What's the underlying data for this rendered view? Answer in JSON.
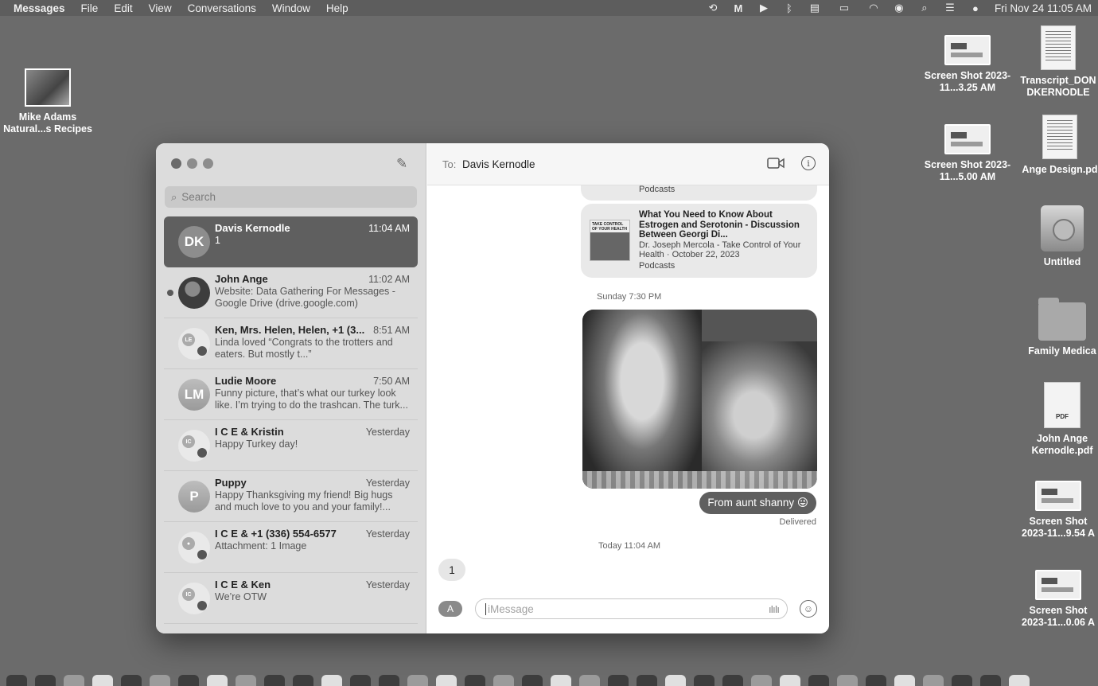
{
  "menubar": {
    "app": "Messages",
    "items": [
      "File",
      "Edit",
      "View",
      "Conversations",
      "Window",
      "Help"
    ],
    "clock": "Fri Nov 24  11:05 AM",
    "status_icons": [
      "sync-icon",
      "malwarebytes-icon",
      "play-icon",
      "bluetooth-icon",
      "keyboard-icon",
      "battery-icon",
      "wifi-icon",
      "user-icon",
      "search-icon",
      "control-center-icon",
      "siri-icon"
    ]
  },
  "desktop": {
    "icons": [
      {
        "label": "Mike Adams Natural...s Recipes",
        "type": "photo"
      },
      {
        "label": "Screen Shot 2023-11...3.25 AM",
        "type": "screenshot"
      },
      {
        "label": "Transcript_DON DKERNODLE",
        "type": "document"
      },
      {
        "label": "Screen Shot 2023-11...5.00 AM",
        "type": "screenshot"
      },
      {
        "label": "Ange Design.pd",
        "type": "document"
      },
      {
        "label": "Untitled",
        "type": "disk"
      },
      {
        "label": "Family Medica",
        "type": "folder"
      },
      {
        "label": "John Ange Kernodle.pdf",
        "type": "pdf"
      },
      {
        "label": "Screen Shot 2023-11...9.54 A",
        "type": "screenshot"
      },
      {
        "label": "Screen Shot 2023-11...0.06 A",
        "type": "screenshot"
      }
    ]
  },
  "sidebar": {
    "search_placeholder": "Search",
    "conversations": [
      {
        "initials": "DK",
        "name": "Davis Kernodle",
        "time": "11:04 AM",
        "preview": "1",
        "selected": true
      },
      {
        "initials": "",
        "name": "John Ange",
        "time": "11:02 AM",
        "preview": "Website: Data Gathering For Messages - Google Drive (drive.google.com)",
        "unread": true
      },
      {
        "initials": "LE",
        "name": "Ken, Mrs. Helen, Helen, +1 (3...",
        "time": "8:51 AM",
        "preview": "Linda loved “Congrats to the trotters and eaters.  But mostly t...”"
      },
      {
        "initials": "LM",
        "name": "Ludie Moore",
        "time": "7:50 AM",
        "preview": "Funny picture, that’s what our turkey look like. I’m trying to do the trashcan. The turk..."
      },
      {
        "initials": "IC",
        "name": "I C E & Kristin",
        "time": "Yesterday",
        "preview": "Happy Turkey day!"
      },
      {
        "initials": "P",
        "name": "Puppy",
        "time": "Yesterday",
        "preview": "Happy Thanksgiving my friend!  Big hugs and much love to you and your family!..."
      },
      {
        "initials": "",
        "name": "I C E & +1 (336) 554-6577",
        "time": "Yesterday",
        "preview": "Attachment: 1 Image"
      },
      {
        "initials": "IC",
        "name": "I C E & Ken",
        "time": "Yesterday",
        "preview": "We’re OTW"
      }
    ]
  },
  "chat": {
    "to_label": "To:",
    "recipient": "Davis Kernodle",
    "podcast_source": "Podcasts",
    "link_card": {
      "title": "What You Need to Know About Estrogen and Serotonin - Discussion Between Georgi Di...",
      "subtitle": "Dr. Joseph Mercola - Take Control of Your Health · October 22, 2023",
      "source": "Podcasts",
      "thumb_text": "TAKE CONTROL OF YOUR HEALTH"
    },
    "timestamp_1": "Sunday 7:30 PM",
    "sent_message": "From aunt shanny 😜",
    "delivered": "Delivered",
    "timestamp_2": "Today 11:04 AM",
    "received_message": "1",
    "input_placeholder": "iMessage"
  }
}
